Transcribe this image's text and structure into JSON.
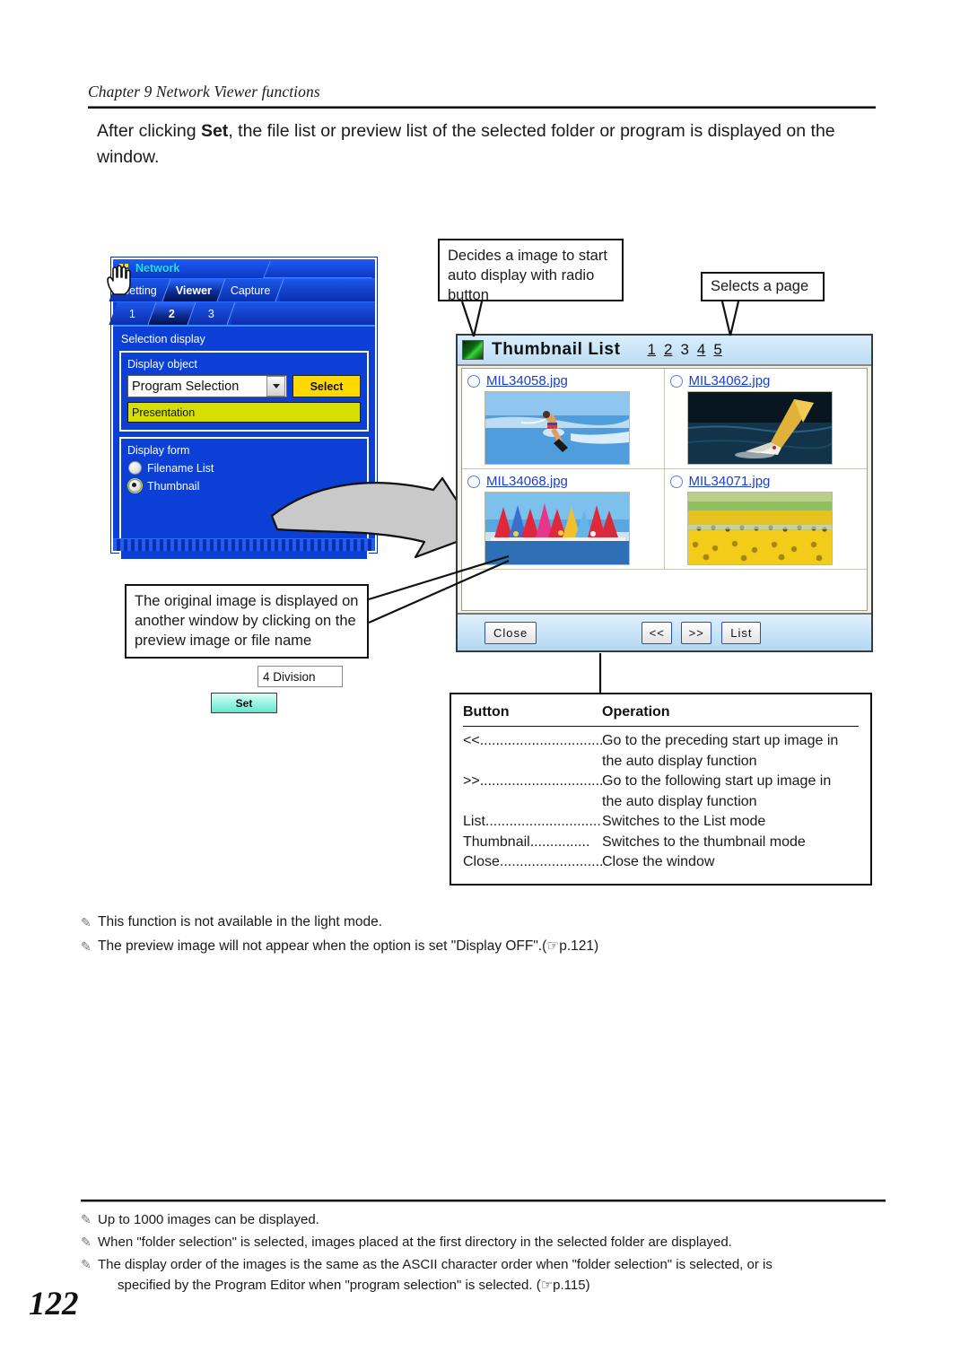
{
  "page": {
    "chapter_header": "Chapter 9 Network Viewer functions",
    "page_number": "122",
    "intro_pre": "After clicking ",
    "intro_bold": "Set",
    "intro_post": ", the file list or preview list of the selected folder or program is displayed on the window."
  },
  "network_dialog": {
    "title": "Network",
    "main_tabs": [
      {
        "label": "Setting",
        "selected": false
      },
      {
        "label": "Viewer",
        "selected": true
      },
      {
        "label": "Capture",
        "selected": false
      }
    ],
    "num_tabs": [
      {
        "label": "1",
        "selected": false
      },
      {
        "label": "2",
        "selected": true
      },
      {
        "label": "3",
        "selected": false
      }
    ],
    "section_label": "Selection display",
    "display_object": {
      "panel_label": "Display object",
      "combo_value": "Program Selection",
      "select_button": "Select",
      "program_value": "Presentation"
    },
    "display_form": {
      "panel_label": "Display form",
      "options": [
        {
          "label": "Filename List",
          "selected": false
        },
        {
          "label": "Thumbnail",
          "selected": true
        }
      ],
      "division_value": "4 Division",
      "set_button": "Set"
    }
  },
  "thumbnail_window": {
    "title": "Thumbnail List",
    "pages": [
      {
        "label": "1",
        "link": true
      },
      {
        "label": "2",
        "link": true
      },
      {
        "label": "3",
        "link": false
      },
      {
        "label": "4",
        "link": true
      },
      {
        "label": "5",
        "link": true
      }
    ],
    "items": [
      {
        "filename": "MIL34058.jpg",
        "image": "water-skier"
      },
      {
        "filename": "MIL34062.jpg",
        "image": "sailboat"
      },
      {
        "filename": "MIL34068.jpg",
        "image": "windsurf-fleet"
      },
      {
        "filename": "MIL34071.jpg",
        "image": "sunflower-field"
      }
    ],
    "buttons": {
      "close": "Close",
      "prev": "<<",
      "next": ">>",
      "list": "List"
    }
  },
  "callouts": {
    "radio": "Decides a image to start auto display with radio button",
    "page": "Selects a page",
    "original": "The original image is displayed on another window by clicking on the preview image or file name"
  },
  "operation_table": {
    "header": {
      "button": "Button",
      "operation": "Operation"
    },
    "rows": [
      {
        "button": "<<...............................",
        "operation": "Go to the preceding start up image in",
        "cont": "the auto display function"
      },
      {
        "button": ">>...............................",
        "operation": "Go to the following start up image in",
        "cont": "the auto display function"
      },
      {
        "button": "List..............................",
        "operation": "Switches to the List mode",
        "cont": ""
      },
      {
        "button": "Thumbnail...............",
        "operation": "Switches to the thumbnail mode",
        "cont": ""
      },
      {
        "button": "Close..........................",
        "operation": "Close the window",
        "cont": ""
      }
    ]
  },
  "notes_middle": [
    "This function is not available in the light mode.",
    "The preview image will not appear when the option is set \"Display OFF\".(☞p.121)"
  ],
  "notes_bottom": [
    {
      "text": "Up to 1000 images can be displayed.",
      "indent": ""
    },
    {
      "text": "When \"folder selection\" is selected, images placed at the first directory in the selected folder are displayed.",
      "indent": ""
    },
    {
      "text": "The display order of the images is the same as the ASCII character order when \"folder selection\" is selected, or is",
      "indent": "specified by the Program Editor when \"program selection\" is selected. (☞p.115)"
    }
  ],
  "colors": {
    "dialog_blue": "#0b3fd6",
    "select_yellow": "#ffd900",
    "program_green": "#d6e000",
    "set_button_teal": "#62e7cf",
    "link_blue": "#1a3fd0",
    "window_header_blue": "#bcdcf4"
  }
}
